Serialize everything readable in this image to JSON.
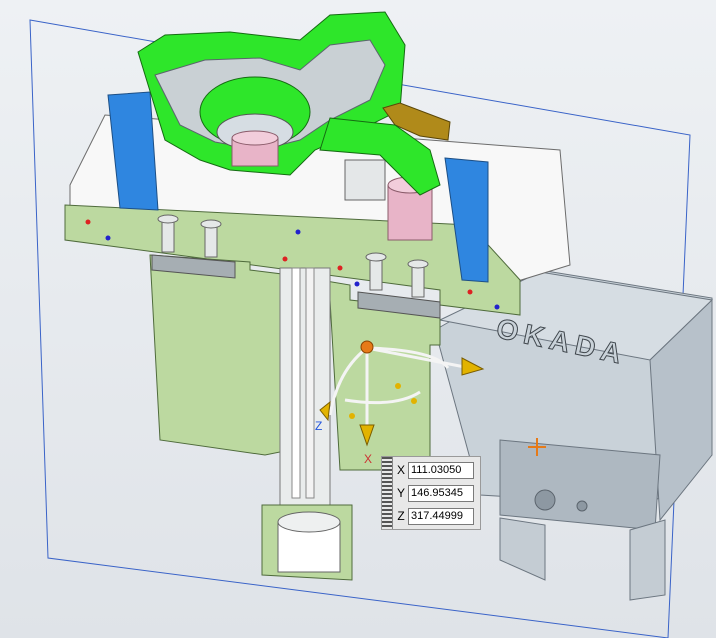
{
  "viewport": {
    "brand_text": "OKADA",
    "axis_labels": {
      "x": "X",
      "z": "Z"
    }
  },
  "coord_panel": {
    "x_label": "X",
    "x_value": "111.03050",
    "y_label": "Y",
    "y_value": "146.95345",
    "z_label": "Z",
    "z_value": "317.44999"
  },
  "colors": {
    "section_green": "#2ee62a",
    "face_green": "#bcd9a0",
    "blue_block": "#2f86e0",
    "housing_gray": "#c9d2d9",
    "pink": "#e8b4c8",
    "gold": "#b08a1a",
    "plane_outline": "#3a63c8"
  }
}
